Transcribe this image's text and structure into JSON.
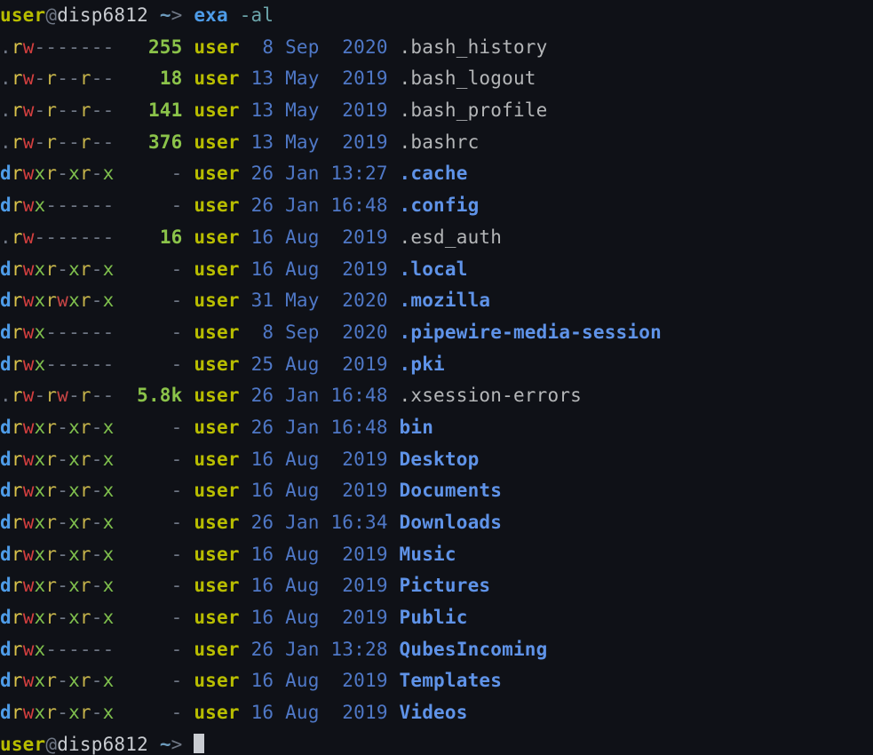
{
  "prompt": {
    "user": "user",
    "at": "@",
    "host": "disp6812",
    "sep": " ",
    "path": "~",
    "arrow": ">",
    "command": "exa",
    "args": "-al"
  },
  "owner_label": "user",
  "files": [
    {
      "perm": ".rw-------",
      "size": "255",
      "date": " 8 Sep  2020",
      "name": ".bash_history",
      "dir": false,
      "hidden": true
    },
    {
      "perm": ".rw-r--r--",
      "size": "18",
      "date": "13 May  2019",
      "name": ".bash_logout",
      "dir": false,
      "hidden": true
    },
    {
      "perm": ".rw-r--r--",
      "size": "141",
      "date": "13 May  2019",
      "name": ".bash_profile",
      "dir": false,
      "hidden": true
    },
    {
      "perm": ".rw-r--r--",
      "size": "376",
      "date": "13 May  2019",
      "name": ".bashrc",
      "dir": false,
      "hidden": true
    },
    {
      "perm": "drwxr-xr-x",
      "size": "-",
      "date": "26 Jan 13:27",
      "name": ".cache",
      "dir": true,
      "hidden": true
    },
    {
      "perm": "drwx------",
      "size": "-",
      "date": "26 Jan 16:48",
      "name": ".config",
      "dir": true,
      "hidden": true
    },
    {
      "perm": ".rw-------",
      "size": "16",
      "date": "16 Aug  2019",
      "name": ".esd_auth",
      "dir": false,
      "hidden": true
    },
    {
      "perm": "drwxr-xr-x",
      "size": "-",
      "date": "16 Aug  2019",
      "name": ".local",
      "dir": true,
      "hidden": true
    },
    {
      "perm": "drwxrwxr-x",
      "size": "-",
      "date": "31 May  2020",
      "name": ".mozilla",
      "dir": true,
      "hidden": true
    },
    {
      "perm": "drwx------",
      "size": "-",
      "date": " 8 Sep  2020",
      "name": ".pipewire-media-session",
      "dir": true,
      "hidden": true
    },
    {
      "perm": "drwx------",
      "size": "-",
      "date": "25 Aug  2019",
      "name": ".pki",
      "dir": true,
      "hidden": true
    },
    {
      "perm": ".rw-rw-r--",
      "size": "5.8k",
      "date": "26 Jan 16:48",
      "name": ".xsession-errors",
      "dir": false,
      "hidden": true
    },
    {
      "perm": "drwxr-xr-x",
      "size": "-",
      "date": "26 Jan 16:48",
      "name": "bin",
      "dir": true,
      "hidden": false
    },
    {
      "perm": "drwxr-xr-x",
      "size": "-",
      "date": "16 Aug  2019",
      "name": "Desktop",
      "dir": true,
      "hidden": false
    },
    {
      "perm": "drwxr-xr-x",
      "size": "-",
      "date": "16 Aug  2019",
      "name": "Documents",
      "dir": true,
      "hidden": false
    },
    {
      "perm": "drwxr-xr-x",
      "size": "-",
      "date": "26 Jan 16:34",
      "name": "Downloads",
      "dir": true,
      "hidden": false
    },
    {
      "perm": "drwxr-xr-x",
      "size": "-",
      "date": "16 Aug  2019",
      "name": "Music",
      "dir": true,
      "hidden": false
    },
    {
      "perm": "drwxr-xr-x",
      "size": "-",
      "date": "16 Aug  2019",
      "name": "Pictures",
      "dir": true,
      "hidden": false
    },
    {
      "perm": "drwxr-xr-x",
      "size": "-",
      "date": "16 Aug  2019",
      "name": "Public",
      "dir": true,
      "hidden": false
    },
    {
      "perm": "drwx------",
      "size": "-",
      "date": "26 Jan 13:28",
      "name": "QubesIncoming",
      "dir": true,
      "hidden": false
    },
    {
      "perm": "drwxr-xr-x",
      "size": "-",
      "date": "16 Aug  2019",
      "name": "Templates",
      "dir": true,
      "hidden": false
    },
    {
      "perm": "drwxr-xr-x",
      "size": "-",
      "date": "16 Aug  2019",
      "name": "Videos",
      "dir": true,
      "hidden": false
    }
  ]
}
